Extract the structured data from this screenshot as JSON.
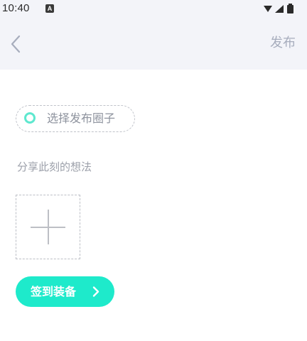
{
  "status_bar": {
    "time": "10:40",
    "notification_glyph": "A",
    "icons": [
      "wifi-icon",
      "signal-icon",
      "battery-icon"
    ]
  },
  "header": {
    "back_icon": "chevron-left-icon",
    "publish_label": "发布"
  },
  "form": {
    "circle_select_label": "选择发布圈子",
    "thoughts_placeholder": "分享此刻的想法",
    "add_image_icon": "plus-icon"
  },
  "checkin_button": {
    "label": "签到装备",
    "icon": "chevron-right-icon"
  },
  "colors": {
    "accent": "#1eeacb",
    "circle_ring": "#5ee8cf",
    "header_bg": "#f3f4f9",
    "muted_text": "#a7adbd"
  }
}
